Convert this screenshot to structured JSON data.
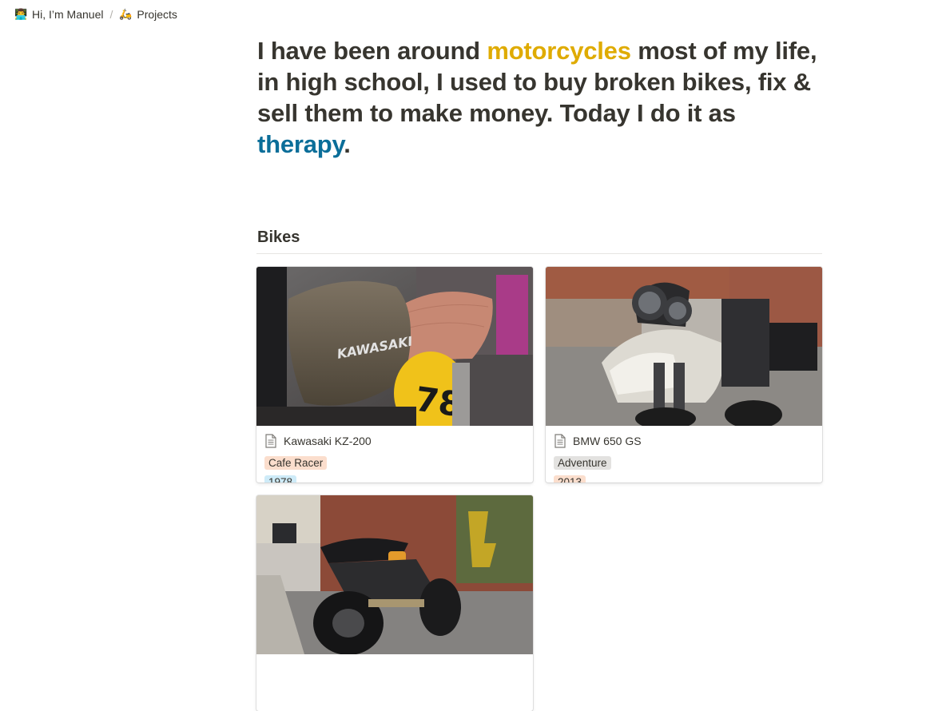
{
  "breadcrumb": {
    "items": [
      {
        "emoji": "👨‍💻",
        "label": "Hi, I’m Manuel"
      },
      {
        "emoji": "🛵",
        "label": "Projects"
      }
    ],
    "separator": "/"
  },
  "headline": {
    "part1": "I have been around ",
    "highlight1": "motorcycles",
    "part2": " most of my life, in high school, I used to buy broken bikes, fix & sell them to make money.  Today I do it as ",
    "highlight2": "therapy",
    "part3": ".",
    "highlight1_color": "#dfab01",
    "highlight2_color": "#0b6e99"
  },
  "section": {
    "title": "Bikes"
  },
  "cards": [
    {
      "title": "Kawasaki KZ-200",
      "icon": "page-icon",
      "tags": [
        {
          "label": "Cafe Racer",
          "color": "orange"
        },
        {
          "label": "1978",
          "color": "blue"
        }
      ],
      "cover_text": "KAWASAKI",
      "cover_number": "78"
    },
    {
      "title": "BMW 650 GS",
      "icon": "page-icon",
      "tags": [
        {
          "label": "Adventure",
          "color": "gray"
        },
        {
          "label": "2013",
          "color": "orange"
        }
      ]
    },
    {
      "title": "",
      "icon": "page-icon",
      "tags": []
    }
  ]
}
